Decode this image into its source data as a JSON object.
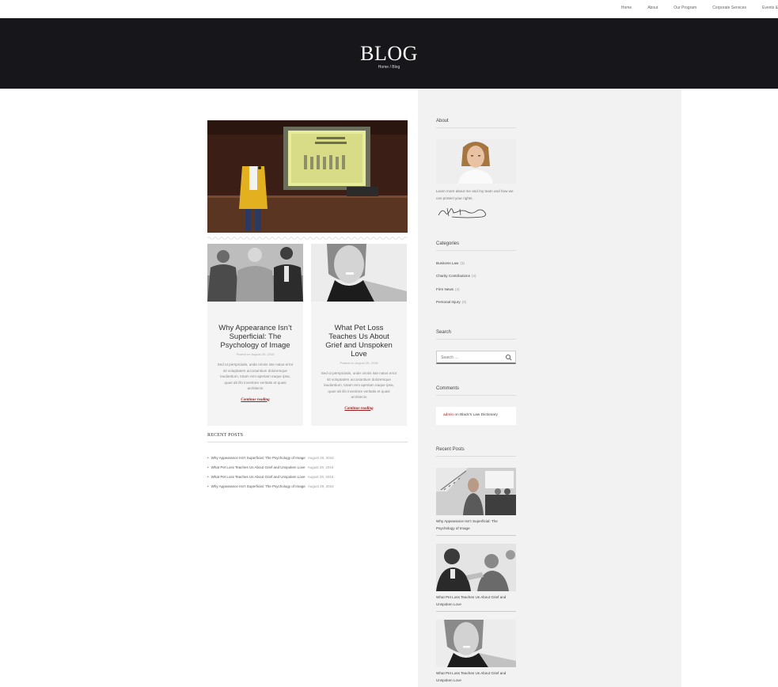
{
  "nav": {
    "items": [
      "Home",
      "About",
      "Our Program",
      "Corporate Services",
      "Events &"
    ]
  },
  "hero": {
    "title": "BLOG",
    "breadcrumb": "Home / Blog"
  },
  "posts": [
    {
      "title": "Why Appearance Isn’t Superficial: The Psychology of Image",
      "date": "Posted on August 29, 2016",
      "excerpt": "Sed ut perspiciatis, unde omnis iste natus error sit voluptatem accusantium doloremque laudantium, totam rem aperiam eaque ipsa, quae ab illo inventore veritatis et quasi architecto",
      "more": "Continue reading"
    },
    {
      "title": "What Pet Loss Teaches Us About Grief and Unspoken Love",
      "date": "Posted on August 29, 2016",
      "excerpt": "Sed ut perspiciatis, unde omnis iste natus error sit voluptatem accusantium doloremque laudantium, totam rem aperiam eaque ipsa, quae ab illo inventore veritatis et quasi architecto",
      "more": "Continue reading"
    }
  ],
  "recent_posts_main": {
    "title": "RECENT POSTS",
    "items": [
      {
        "text": "Why Appearance Isn’t Superficial: The Psychology of Image",
        "date": "August 29, 2016"
      },
      {
        "text": "What Pet Loss Teaches Us About Grief and Unspoken Love",
        "date": "August 29, 2016"
      },
      {
        "text": "What Pet Loss Teaches Us About Grief and Unspoken Love",
        "date": "August 29, 2016"
      },
      {
        "text": "Why Appearance Isn’t Superficial: The Psychology of Image",
        "date": "August 29, 2016"
      }
    ]
  },
  "sidebar": {
    "about": {
      "title": "About",
      "text": "Learn more about me and my team and how we can protect your rights."
    },
    "categories": {
      "title": "Categories",
      "items": [
        {
          "name": "Business Law",
          "count": "(3)"
        },
        {
          "name": "Charity Contributions",
          "count": "(4)"
        },
        {
          "name": "Firm News",
          "count": "(4)"
        },
        {
          "name": "Personal Injury",
          "count": "(4)"
        }
      ]
    },
    "search": {
      "title": "Search",
      "placeholder": "Search …"
    },
    "comments": {
      "title": "Comments",
      "author": "admin",
      "on": " on ",
      "post": "Black's Law Dictionary"
    },
    "recent": {
      "title": "Recent Posts",
      "items": [
        {
          "caption": "Why Appearance Isn’t Superficial: The Psychology of Image"
        },
        {
          "caption": "What Pet Loss Teaches Us About Grief and Unspoken Love"
        },
        {
          "caption": "What Pet Loss Teaches Us About Grief and Unspoken Love"
        }
      ]
    }
  },
  "colors": {
    "hero_bg": "#17161b",
    "sidebar_bg": "#f2f2f2",
    "accent": "#9b1c1c"
  }
}
